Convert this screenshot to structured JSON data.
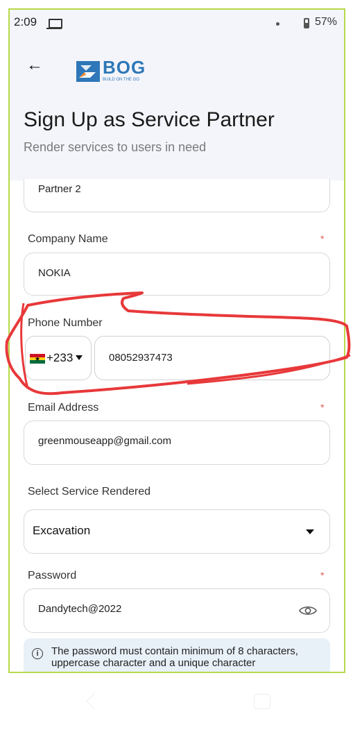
{
  "status_bar": {
    "time": "2:09",
    "battery": "57%",
    "icons": [
      "laptop-icon",
      "dot-icon",
      "battery-icon"
    ]
  },
  "header": {
    "back_icon": "arrow-left-icon",
    "logo_text": "BOG",
    "logo_tagline": "BUILD ON THE GO",
    "title": "Sign Up as Service Partner",
    "subtitle": "Render services to users in need"
  },
  "form": {
    "partial_field_value": "Partner 2",
    "company": {
      "label": "Company Name",
      "required_mark": "*",
      "value": "NOKIA"
    },
    "phone": {
      "label": "Phone Number",
      "country_code": "+233",
      "country_flag": "ghana-flag-icon",
      "value": "08052937473"
    },
    "email": {
      "label": "Email Address",
      "required_mark": "*",
      "value": "greenmouseapp@gmail.com"
    },
    "service": {
      "label": "Select Service Rendered",
      "value": "Excavation"
    },
    "password": {
      "label": "Password",
      "required_mark": "*",
      "value": "Dandytech@2022"
    },
    "password_hint": "The password must contain minimum of 8 characters, uppercase character and a unique character"
  },
  "colors": {
    "brand": "#2e77b8",
    "required": "#e05a4e",
    "annotation": "#e8383a",
    "header_bg": "#f4f5fb",
    "frame_border": "#b8d94a"
  }
}
